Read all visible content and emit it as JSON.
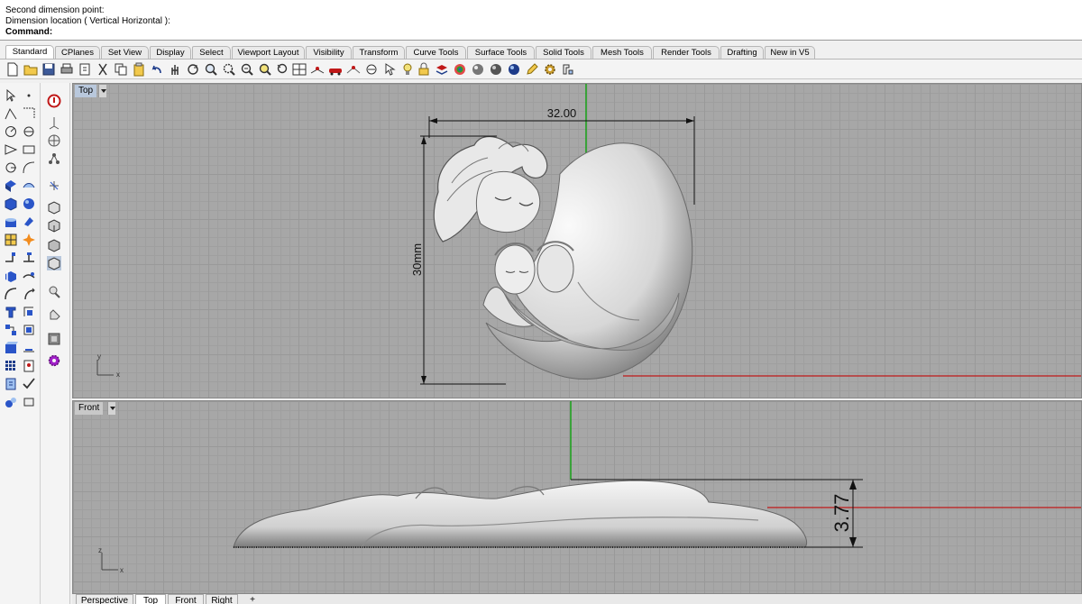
{
  "command": {
    "history": [
      "Second dimension point:",
      "Dimension location ( Vertical  Horizontal ):"
    ],
    "prompt": "Command:",
    "value": ""
  },
  "tabs": [
    "Standard",
    "CPlanes",
    "Set View",
    "Display",
    "Select",
    "Viewport Layout",
    "Visibility",
    "Transform",
    "Curve Tools",
    "Surface Tools",
    "Solid Tools",
    "Mesh Tools",
    "Render Tools",
    "Drafting",
    "New in V5"
  ],
  "active_tab": "Standard",
  "toolbar_icons": [
    "new-file-icon",
    "open-file-icon",
    "save-icon",
    "print-icon",
    "import-icon",
    "cut-icon",
    "copy-icon",
    "paste-icon",
    "undo-icon",
    "pan-icon",
    "rotate-view-icon",
    "zoom-icon",
    "zoom-window-icon",
    "zoom-extents-icon",
    "zoom-selected-icon",
    "undo-view-icon",
    "four-viewports-icon",
    "move-cplane-icon",
    "car-icon",
    "wire-icon",
    "cplane-icon",
    "select-icon",
    "light-icon",
    "lock-icon",
    "layer-icon",
    "color-icon",
    "render-sphere-icon",
    "shaded-sphere-icon",
    "environment-sphere-icon",
    "pencil-icon",
    "gear-icon",
    "options-icon"
  ],
  "left_tools": [
    "point-icon",
    "polyline-icon",
    "circle-icon",
    "arc-icon",
    "ellipse-icon",
    "rectangle-icon",
    "polygon-icon",
    "curve-icon",
    "free-curve-icon",
    "fillet-curve-icon",
    "surface-icon",
    "loft-icon",
    "box-icon",
    "sphere-icon",
    "extrude-icon",
    "boolean-icon",
    "mesh-icon",
    "explode-icon",
    "join-icon",
    "trim-icon",
    "split-icon",
    "extend-icon",
    "offset-icon",
    "move-icon",
    "rotate-icon",
    "scale-icon",
    "text-icon",
    "dimension-icon",
    "group-icon",
    "array-icon",
    "analyze-icon",
    "render-icon",
    "history-icon",
    "check-icon"
  ],
  "osnap_tools": [
    "stop-icon",
    "gumball-icon",
    "cplane-grid-icon",
    "snap-tree-icon",
    "osnap-end-icon",
    "box-view-icon",
    "box-view-2-icon",
    "box-view-3-icon",
    "box-view-active-icon",
    "zoom-tool-icon",
    "hand-tool-icon",
    "display-mode-icon",
    "plugin-icon"
  ],
  "viewports": {
    "top": {
      "label": "Top",
      "axis_x": "x",
      "axis_y": "y",
      "dim_horizontal": "32.00",
      "dim_vertical": "30mm"
    },
    "front": {
      "label": "Front",
      "axis_x": "x",
      "axis_y": "z",
      "dim_height": "3.77"
    }
  },
  "view_tabs": [
    "Perspective",
    "Top",
    "Front",
    "Right",
    "+"
  ],
  "active_view_tab": "Top",
  "colors": {
    "grid_bg": "#a7a7a7",
    "x_axis": "#c01818",
    "y_axis": "#00a000",
    "active_label": "#b9c8dc"
  }
}
